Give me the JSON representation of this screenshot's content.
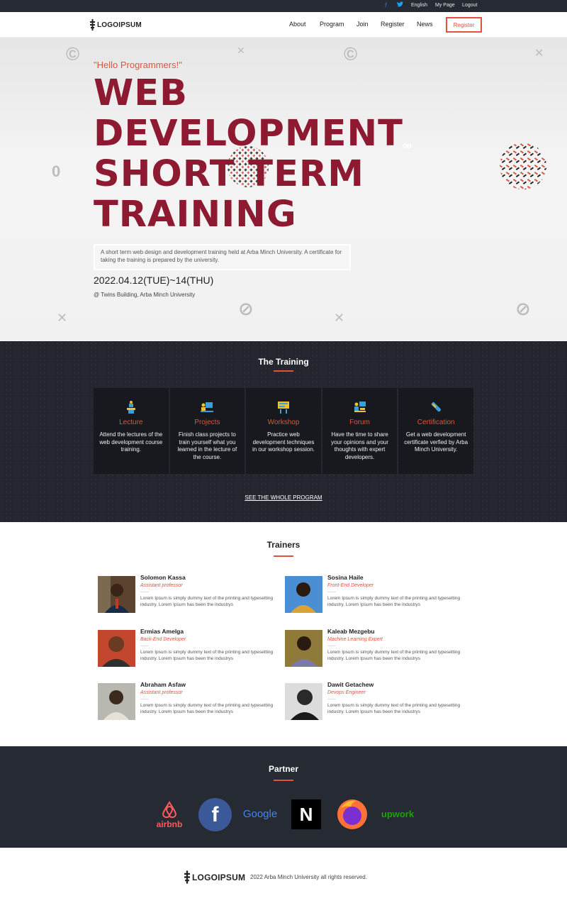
{
  "topbar": {
    "facebook_icon": "f",
    "twitter_icon": "t",
    "links": [
      "English",
      "My Page",
      "Logout"
    ]
  },
  "header": {
    "logo_text": "LOGOIPSUM",
    "nav": [
      "About",
      "Program",
      "Join",
      "Register",
      "News"
    ],
    "register_button": "Register"
  },
  "hero": {
    "greeting": "\"Hello Programmers!\"",
    "title_lines": [
      "WEB",
      "DEVELOPMENT",
      "SHORT TERM",
      "TRAINING"
    ],
    "description": "A short term web design and development training held at Arba Minch University. A certificate for taking the training is prepared by the university.",
    "date": "2022.04.12(TUE)~14(THU)",
    "location": "@ Twins Building, Arba Minch University"
  },
  "training": {
    "title": "The Training",
    "cards": [
      {
        "icon": "lecture-icon",
        "title": "Lecture",
        "text": "Attend the lectures of the web development course training."
      },
      {
        "icon": "projects-icon",
        "title": "Projects",
        "text": "Finish class projects to train yourself what you learned in the lecture of the course."
      },
      {
        "icon": "workshop-icon",
        "title": "Workshop",
        "text": "Practice web development techniques in our workshop session."
      },
      {
        "icon": "forum-icon",
        "title": "Forum",
        "text": "Have the time to share your opinions and your thoughts with expert developers."
      },
      {
        "icon": "certification-icon",
        "title": "Certification",
        "text": "Get a web development certificate verfied by Arba Minch University."
      }
    ],
    "link": "SEE THE WHOLE PROGRAM"
  },
  "trainers": {
    "title": "Trainers",
    "list": [
      {
        "name": "Solomon Kassa",
        "role": "Assistant professor",
        "bio": "Lorem Ipsum is simply dummy text of the printing and typesetting industry. Lorem Ipsum has been the industrys"
      },
      {
        "name": "Sosina Haile",
        "role": "Front-End Developer",
        "bio": "Lorem Ipsum is simply dummy text of the printing and typesetting industry. Lorem Ipsum has been the industrys"
      },
      {
        "name": "Ermias Amelga",
        "role": "Back-End Developer",
        "bio": "Lorem Ipsum is simply dummy text of the printing and typesetting industry. Lorem Ipsum has been the industrys"
      },
      {
        "name": "Kaleab Mezgebu",
        "role": "Machine Learning Expert",
        "bio": "Lorem Ipsum is simply dummy text of the printing and typesetting industry. Lorem Ipsum has been the industrys"
      },
      {
        "name": "Abraham Asfaw",
        "role": "Assistant professor",
        "bio": "Lorem Ipsum is simply dummy text of the printing and typesetting industry. Lorem Ipsum has been the industrys"
      },
      {
        "name": "Dawit Getachew",
        "role": "Devops Engineer",
        "bio": "Lorem Ipsum is simply dummy text of the printing and typesetting industry. Lorem Ipsum has been the industrys"
      }
    ]
  },
  "partner": {
    "title": "Partner",
    "logos": [
      "airbnb",
      "f",
      "Google",
      "N",
      "firefox",
      "upwork"
    ]
  },
  "footer": {
    "logo_text": "LOGOIPSUM",
    "copyright": "2022 Arba Minch University all rights reserved."
  },
  "colors": {
    "accent": "#e0533d",
    "dark": "#262a33",
    "title": "#8d1a30"
  }
}
